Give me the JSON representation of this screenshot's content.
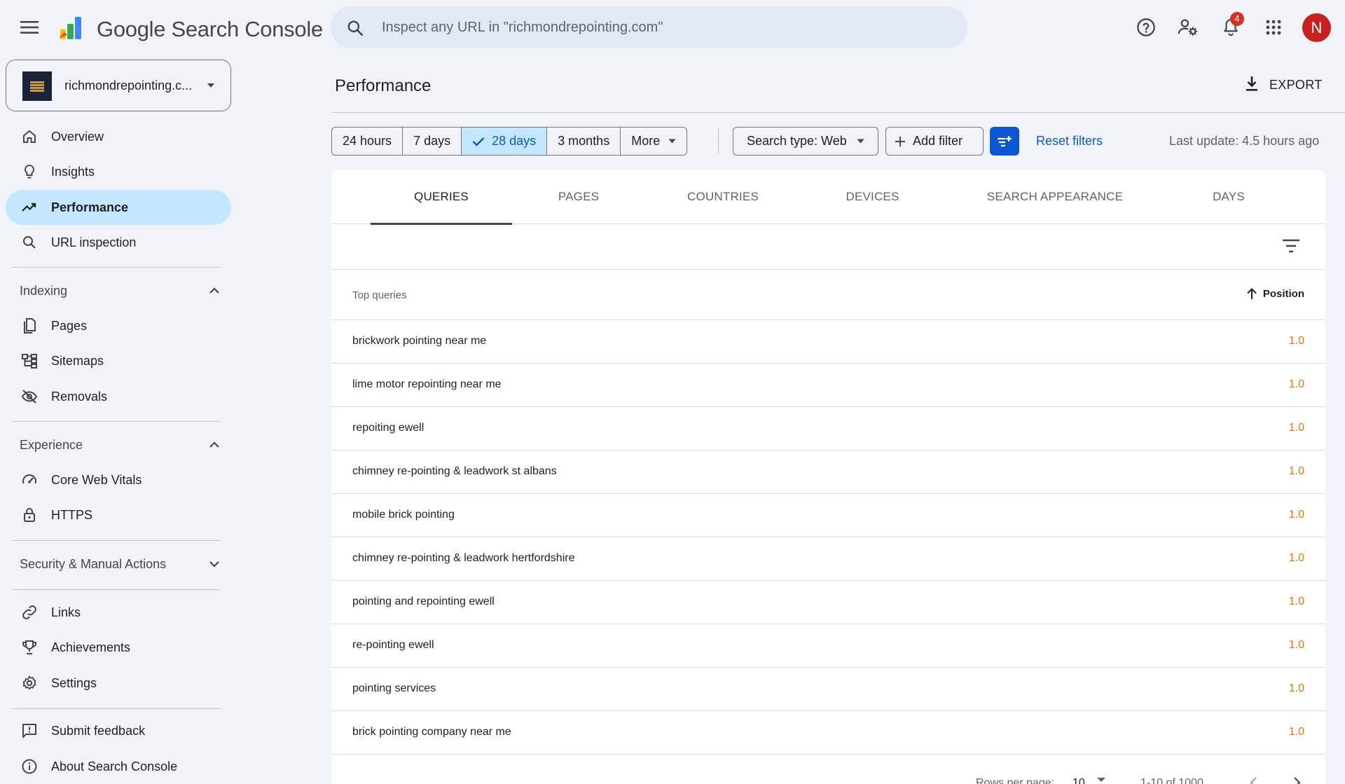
{
  "app": {
    "product_name": "Google Search Console",
    "search_placeholder": "Inspect any URL in \"richmondrepointing.com\"",
    "notifications_count": "4",
    "avatar_letter": "N"
  },
  "sidebar": {
    "property_name": "richmondrepointing.c...",
    "primary_items": [
      {
        "label": "Overview",
        "icon": "home-icon"
      },
      {
        "label": "Insights",
        "icon": "lightbulb-icon"
      },
      {
        "label": "Performance",
        "icon": "trending-up-icon",
        "active": true
      },
      {
        "label": "URL inspection",
        "icon": "search-icon"
      }
    ],
    "indexing": {
      "label": "Indexing",
      "items": [
        {
          "label": "Pages",
          "icon": "pages-icon"
        },
        {
          "label": "Sitemaps",
          "icon": "sitemap-icon"
        },
        {
          "label": "Removals",
          "icon": "eye-off-icon"
        }
      ]
    },
    "experience": {
      "label": "Experience",
      "items": [
        {
          "label": "Core Web Vitals",
          "icon": "speed-icon"
        },
        {
          "label": "HTTPS",
          "icon": "lock-icon"
        }
      ]
    },
    "security_label": "Security & Manual Actions",
    "bottom_items": [
      {
        "label": "Links",
        "icon": "link-icon"
      },
      {
        "label": "Achievements",
        "icon": "trophy-icon"
      },
      {
        "label": "Settings",
        "icon": "gear-icon"
      }
    ],
    "footer_items": [
      {
        "label": "Submit feedback",
        "icon": "feedback-icon"
      },
      {
        "label": "About Search Console",
        "icon": "info-icon"
      }
    ]
  },
  "main": {
    "title": "Performance",
    "export_label": "EXPORT",
    "date_ranges": [
      {
        "label": "24 hours"
      },
      {
        "label": "7 days"
      },
      {
        "label": "28 days",
        "selected": true
      },
      {
        "label": "3 months"
      },
      {
        "label": "More"
      }
    ],
    "search_type": "Search type: Web",
    "add_filter": "Add filter",
    "reset_filters": "Reset filters",
    "last_update": "Last update: 4.5 hours ago",
    "tabs": [
      {
        "label": "QUERIES",
        "active": true
      },
      {
        "label": "PAGES"
      },
      {
        "label": "COUNTRIES"
      },
      {
        "label": "DEVICES"
      },
      {
        "label": "SEARCH APPEARANCE"
      },
      {
        "label": "DAYS"
      }
    ],
    "table": {
      "col_query": "Top queries",
      "col_position": "Position",
      "rows": [
        {
          "query": "brickwork pointing near me",
          "position": "1.0"
        },
        {
          "query": "lime motor repointing near me",
          "position": "1.0"
        },
        {
          "query": "repoiting ewell",
          "position": "1.0"
        },
        {
          "query": "chimney re-pointing & leadwork st albans",
          "position": "1.0"
        },
        {
          "query": "mobile brick pointing",
          "position": "1.0"
        },
        {
          "query": "chimney re-pointing & leadwork hertfordshire",
          "position": "1.0"
        },
        {
          "query": "pointing and repointing ewell",
          "position": "1.0"
        },
        {
          "query": "re-pointing ewell",
          "position": "1.0"
        },
        {
          "query": "pointing services",
          "position": "1.0"
        },
        {
          "query": "brick pointing company near me",
          "position": "1.0"
        }
      ]
    },
    "pagination": {
      "rows_per_page_label": "Rows per page:",
      "rows_per_page_value": "10",
      "range": "1-10 of 1000"
    }
  },
  "colors": {
    "accent": "#0b57d0",
    "active_nav": "#c2e7ff",
    "position_value": "#e37400",
    "background": "#f0f4f9"
  }
}
